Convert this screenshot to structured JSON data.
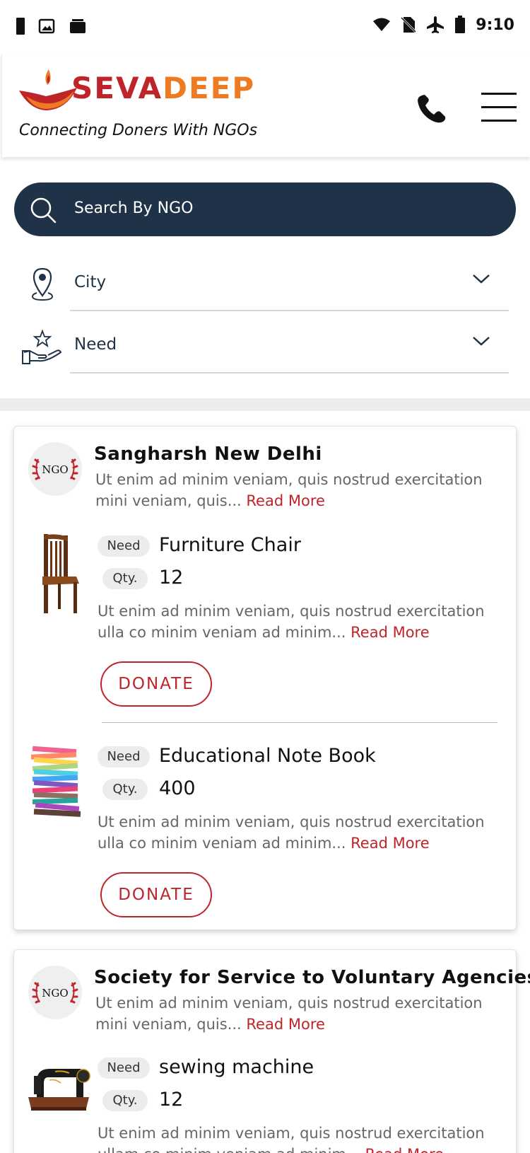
{
  "status_bar": {
    "time": "9:10"
  },
  "header": {
    "logo_part1": "SEVA",
    "logo_part2": "DEEP",
    "tagline": "Connecting Doners With NGOs",
    "brand_red": "#c0242b",
    "brand_orange": "#ee7a22"
  },
  "search": {
    "placeholder": "Search By NGO",
    "bg_color": "#1f3247"
  },
  "filters": [
    {
      "label": "City",
      "icon": "location-pin-icon"
    },
    {
      "label": "Need",
      "icon": "hand-star-icon"
    }
  ],
  "ngo_badge_text": "NGO",
  "cards": [
    {
      "ngo_name": "Sangharsh New Delhi",
      "description": "Ut enim ad minim veniam, quis nostrud exercitation mini  veniam, quis...",
      "read_more": "Read More",
      "items": [
        {
          "need_label": "Need",
          "name": "Furniture Chair",
          "qty_label": "Qty.",
          "qty": "12",
          "description": "Ut enim ad minim veniam, quis nostrud exercitation ulla co minim veniam ad minim...",
          "read_more": "Read More",
          "donate": "DONATE",
          "image": "chair-image"
        },
        {
          "need_label": "Need",
          "name": "Educational Note Book",
          "qty_label": "Qty.",
          "qty": "400",
          "description": "Ut enim ad minim veniam, quis nostrud exercitation ulla co minim veniam ad minim...",
          "read_more": "Read More",
          "donate": "DONATE",
          "image": "notebooks-image"
        }
      ]
    },
    {
      "ngo_name": "Society for Service to Voluntary Agencies",
      "description": "Ut enim ad minim veniam, quis nostrud exercitation mini  veniam, quis...",
      "read_more": "Read More",
      "items": [
        {
          "need_label": "Need",
          "name": "sewing machine",
          "qty_label": "Qty.",
          "qty": "12",
          "description": "Ut enim ad minim veniam, quis nostrud exercitation ullam co minim veniam ad minim...",
          "read_more": "Read More",
          "image": "sewing-machine-image"
        }
      ]
    }
  ]
}
